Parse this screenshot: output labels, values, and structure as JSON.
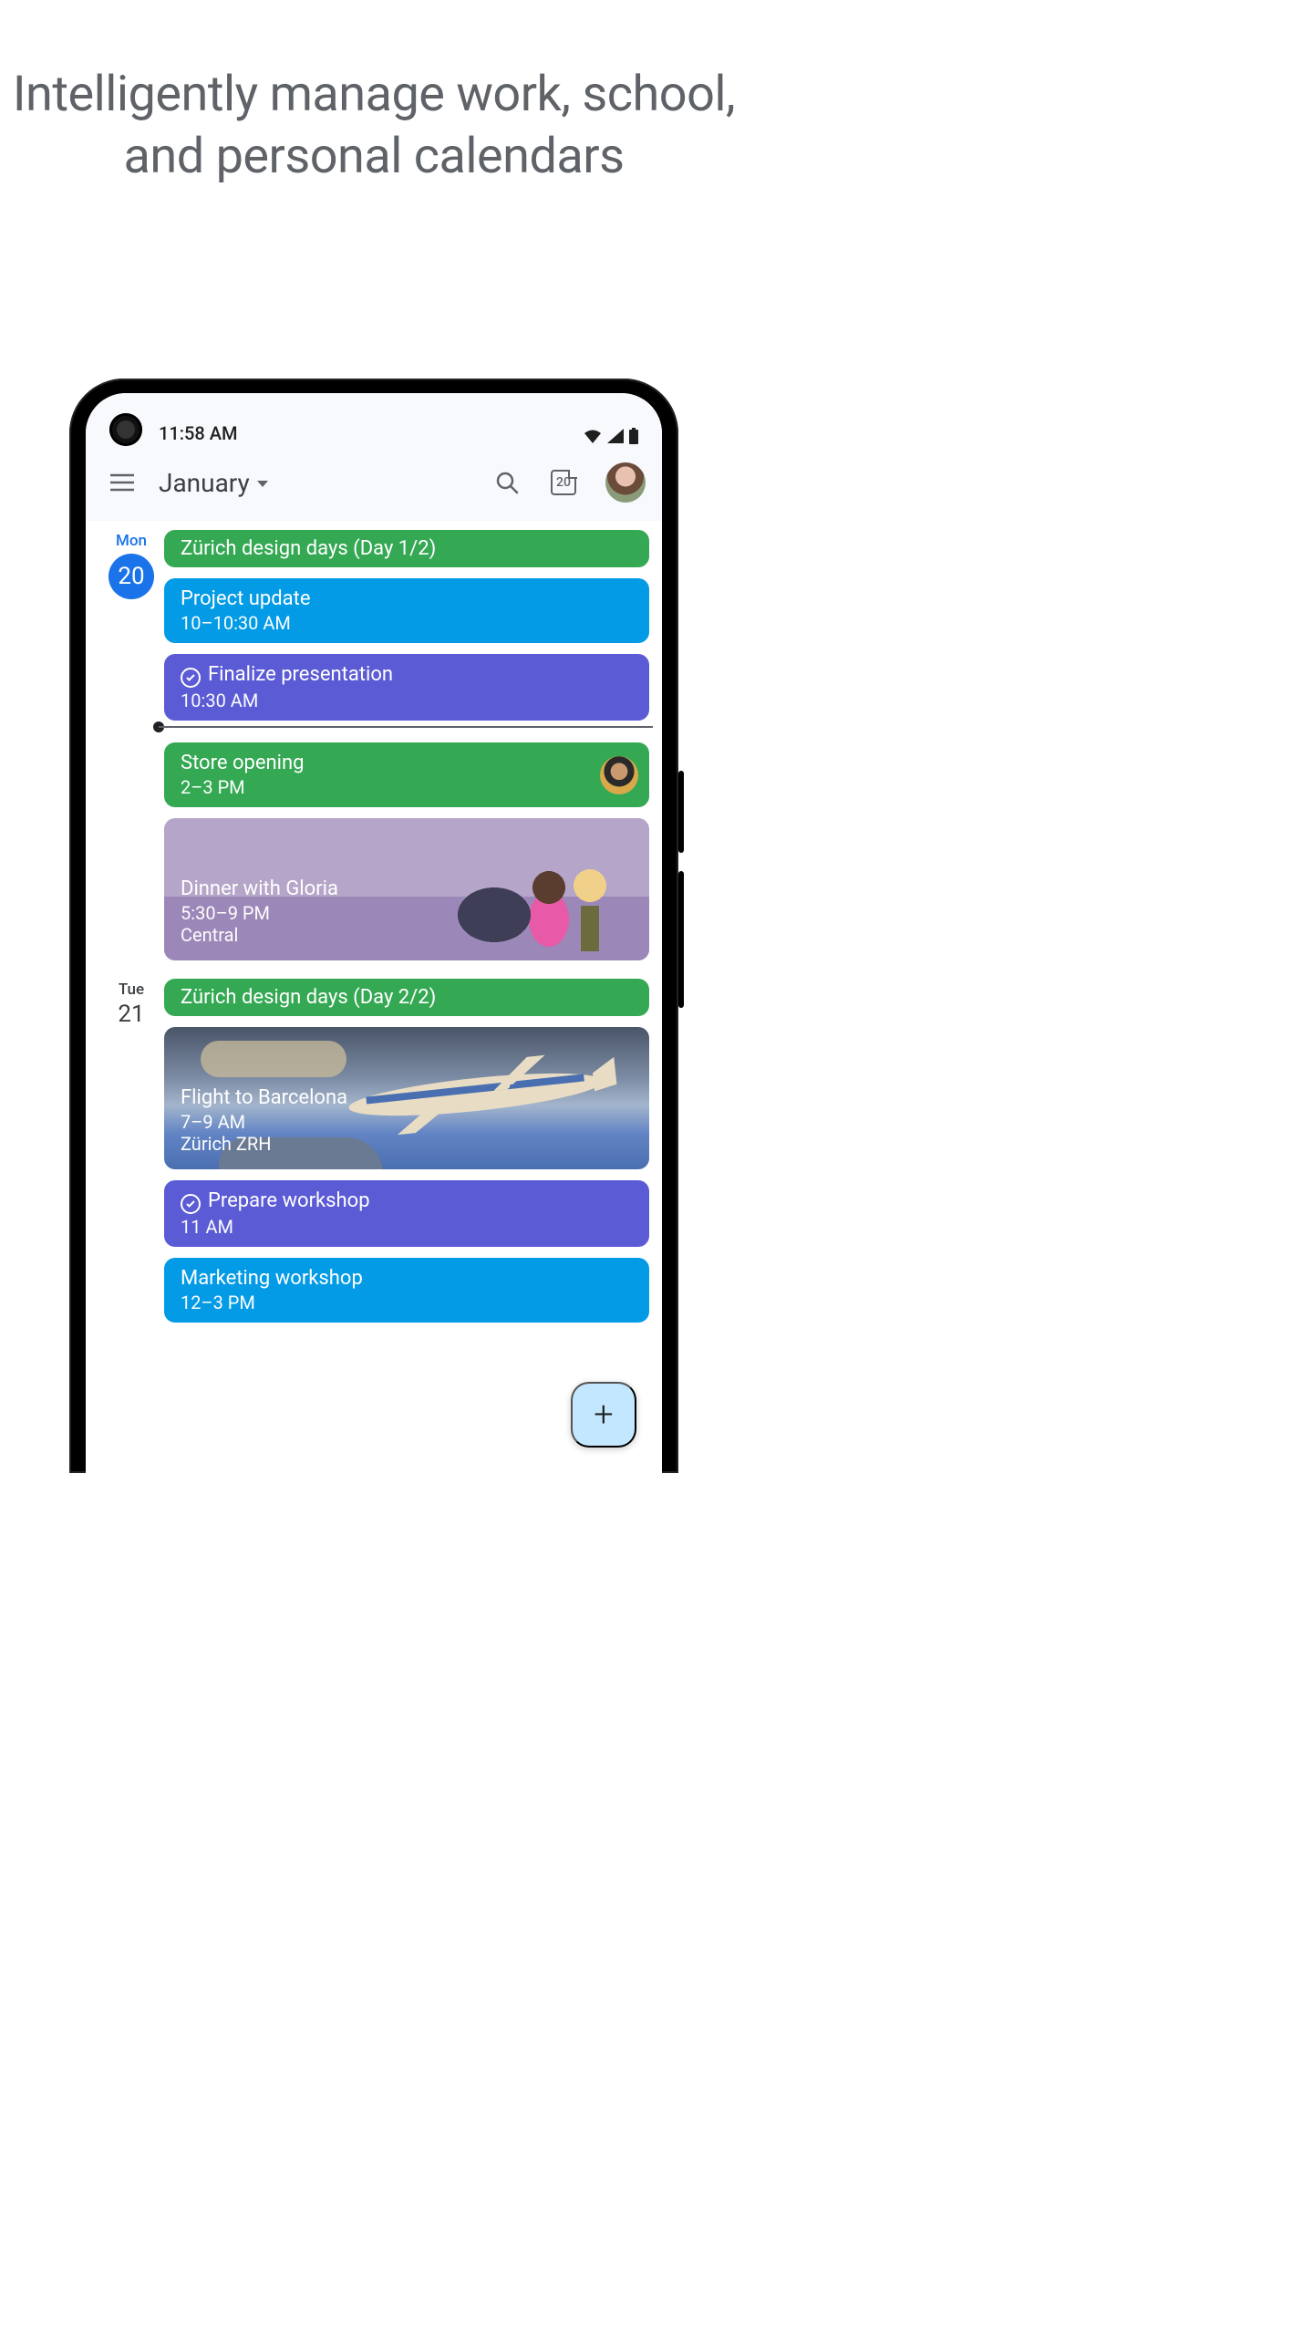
{
  "headline": "Intelligently manage work, school, and personal calendars",
  "status": {
    "time": "11:58 AM"
  },
  "appbar": {
    "month": "January",
    "today_day": "20"
  },
  "days": [
    {
      "dow": "Mon",
      "num": "20",
      "is_today": true,
      "events": [
        {
          "type": "banner",
          "color": "green",
          "title": "Zürich design days (Day 1/2)"
        },
        {
          "type": "evt",
          "color": "blue",
          "title": "Project update",
          "sub": "10–10:30 AM"
        },
        {
          "type": "evt",
          "color": "indigo",
          "title": "Finalize presentation",
          "sub": "10:30 AM",
          "check": true
        },
        {
          "type": "nowline"
        },
        {
          "type": "evt",
          "color": "green",
          "title": "Store opening",
          "sub": "2–3 PM",
          "attendee": true
        },
        {
          "type": "illus",
          "variant": "dinner",
          "title": "Dinner with Gloria",
          "sub": "5:30–9 PM",
          "sub2": "Central"
        }
      ]
    },
    {
      "dow": "Tue",
      "num": "21",
      "is_today": false,
      "events": [
        {
          "type": "banner",
          "color": "green",
          "title": "Zürich design days (Day 2/2)"
        },
        {
          "type": "illus",
          "variant": "flight",
          "title": "Flight to Barcelona",
          "sub": "7–9 AM",
          "sub2": "Zürich ZRH"
        },
        {
          "type": "evt",
          "color": "indigo",
          "title": "Prepare workshop",
          "sub": "11 AM",
          "check": true
        },
        {
          "type": "evt",
          "color": "blue",
          "title": "Marketing workshop",
          "sub": "12–3 PM"
        }
      ]
    }
  ]
}
